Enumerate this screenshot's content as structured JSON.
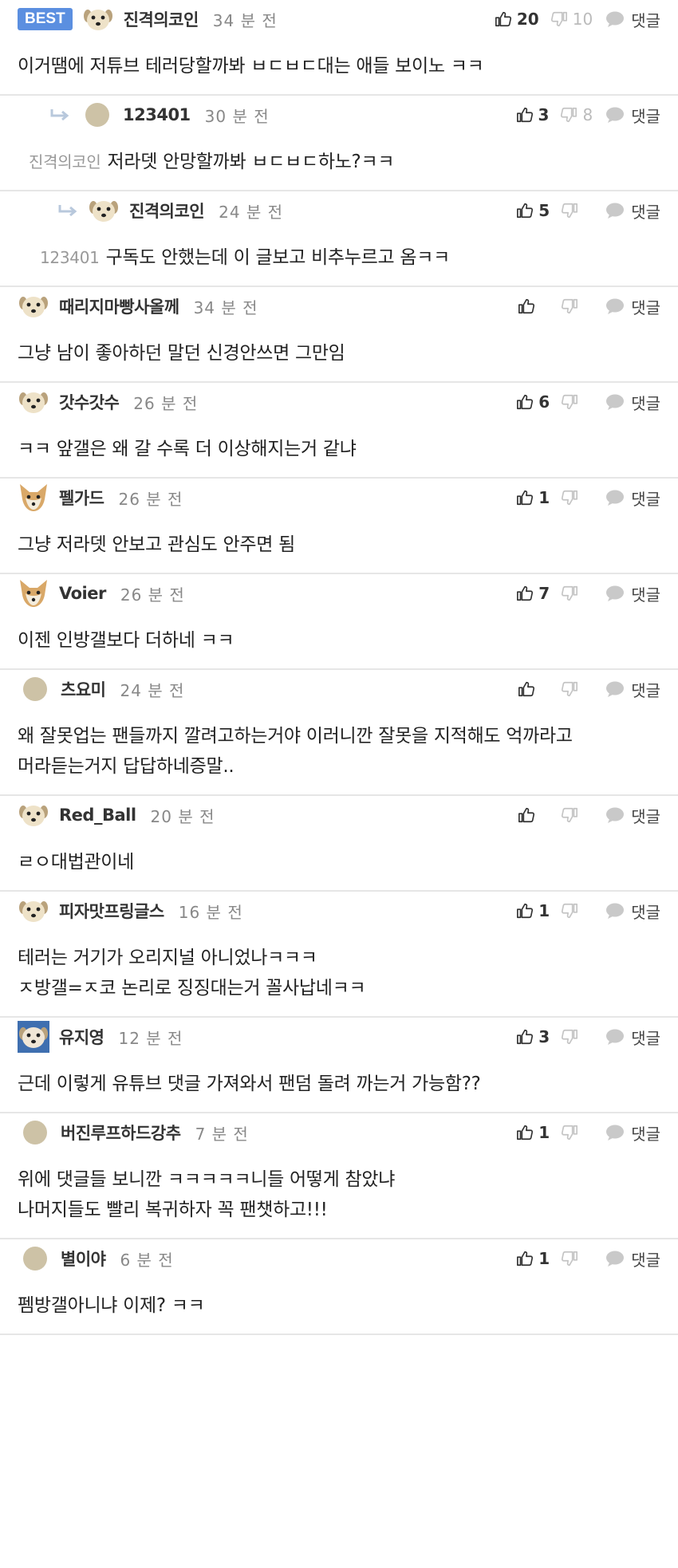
{
  "best_label": "BEST",
  "reply_label": "댓글",
  "comments": [
    {
      "nick": "진격의코인",
      "time": "34 분 전",
      "up": "20",
      "down": "10",
      "text": "이거땜에 저튜브 테러당할까봐 ㅂㄷㅂㄷ대는 애들 보이노 ㅋㅋ",
      "best": true,
      "depth": 0,
      "avatar": "dog-pale"
    },
    {
      "nick": "123401",
      "time": "30 분 전",
      "up": "3",
      "down": "8",
      "mention": "진격의코인",
      "text": "저라뎃 안망할까봐 ㅂㄷㅂㄷ하노?ㅋㅋ",
      "depth": 1,
      "avatar": "dot"
    },
    {
      "nick": "진격의코인",
      "time": "24 분 전",
      "up": "5",
      "down": "",
      "mention": "123401",
      "text": "구독도 안했는데 이 글보고 비추누르고 옴ㅋㅋ",
      "depth": 2,
      "avatar": "dog-pale"
    },
    {
      "nick": "때리지마빵사올께",
      "time": "34 분 전",
      "up": "",
      "down": "",
      "text": "그냥 남이 좋아하던 말던 신경안쓰면 그만임",
      "depth": 0,
      "avatar": "dog-pale"
    },
    {
      "nick": "갓수갓수",
      "time": "26 분 전",
      "up": "6",
      "down": "",
      "text": "ㅋㅋ 앞갤은 왜 갈 수록 더 이상해지는거 같냐",
      "depth": 0,
      "avatar": "dog-pale"
    },
    {
      "nick": "펠가드",
      "time": "26 분 전",
      "up": "1",
      "down": "",
      "text": "그냥 저라뎃 안보고 관심도 안주면 됨",
      "depth": 0,
      "avatar": "fox"
    },
    {
      "nick": "Voier",
      "time": "26 분 전",
      "up": "7",
      "down": "",
      "text": "이젠 인방갤보다 더하네 ㅋㅋ",
      "depth": 0,
      "avatar": "fox"
    },
    {
      "nick": "츠요미",
      "time": "24 분 전",
      "up": "",
      "down": "",
      "text": "왜 잘못업는 팬들까지 깔려고하는거야 이러니깐 잘못을 지적해도 억까라고 머라듣는거지 답답하네증말..",
      "depth": 0,
      "avatar": "dot"
    },
    {
      "nick": "Red_Ball",
      "time": "20 분 전",
      "up": "",
      "down": "",
      "text": "ㄹㅇ대법관이네",
      "depth": 0,
      "avatar": "dog-pale"
    },
    {
      "nick": "피자맛프링글스",
      "time": "16 분 전",
      "up": "1",
      "down": "",
      "text": "테러는 거기가 오리지널 아니었나ㅋㅋㅋ\nㅈ방갤=ㅈ코 논리로 징징대는거 꼴사납네ㅋㅋ",
      "depth": 0,
      "avatar": "dog-pale"
    },
    {
      "nick": "유지영",
      "time": "12 분 전",
      "up": "3",
      "down": "",
      "text": "근데 이렇게 유튜브 댓글 가져와서 팬덤 돌려 까는거 가능함??",
      "depth": 0,
      "avatar": "dog-blue"
    },
    {
      "nick": "버진루프하드강추",
      "time": "7 분 전",
      "up": "1",
      "down": "",
      "text": "위에 댓글들 보니깐 ㅋㅋㅋㅋㅋ니들 어떻게 참았냐\n나머지들도 빨리 복귀하자 꼭 팬챗하고!!!",
      "depth": 0,
      "avatar": "dot"
    },
    {
      "nick": "별이야",
      "time": "6 분 전",
      "up": "1",
      "down": "",
      "text": "펨방갤아니냐 이제? ㅋㅋ",
      "depth": 0,
      "avatar": "dot"
    }
  ]
}
